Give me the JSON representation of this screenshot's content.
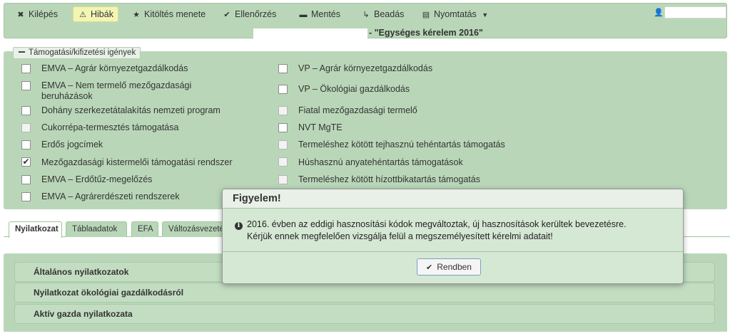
{
  "toolbar": {
    "items": [
      {
        "label": "Kilépés",
        "icon": "close-icon",
        "glyph": "✖"
      },
      {
        "label": "Hibák",
        "icon": "warning-icon",
        "glyph": "⚠"
      },
      {
        "label": "Kitöltés menete",
        "icon": "star-icon",
        "glyph": "★"
      },
      {
        "label": "Ellenőrzés",
        "icon": "check-icon",
        "glyph": "✔"
      },
      {
        "label": "Mentés",
        "icon": "save-icon",
        "glyph": "▬"
      },
      {
        "label": "Beadás",
        "icon": "send-icon",
        "glyph": "↳"
      },
      {
        "label": "Nyomtatás",
        "icon": "print-icon",
        "glyph": "▤"
      }
    ],
    "print_caret": "▼",
    "user_glyph": "👤",
    "title": "- \"Egységes kérelem 2016\""
  },
  "panel": {
    "legend": "Támogatási/kifizetési igények",
    "left": [
      {
        "label": "EMVA – Agrár környezetgazdálkodás",
        "checked": false,
        "disabled": false
      },
      {
        "label": "EMVA – Nem termelő mezőgazdasági beruházások",
        "checked": false,
        "disabled": false
      },
      {
        "label": "Dohány szerkezetátalakítás nemzeti program",
        "checked": false,
        "disabled": false
      },
      {
        "label": "Cukorrépa-termesztés támogatása",
        "checked": false,
        "disabled": true
      },
      {
        "label": "Erdős jogcímek",
        "checked": false,
        "disabled": false
      },
      {
        "label": "Mezőgazdasági kistermelői támogatási rendszer",
        "checked": true,
        "disabled": false
      },
      {
        "label": "EMVA – Erdőtűz-megelőzés",
        "checked": false,
        "disabled": false
      },
      {
        "label": "EMVA – Agrárerdészeti rendszerek",
        "checked": false,
        "disabled": false
      }
    ],
    "right": [
      {
        "label": "VP – Agrár környezetgazdálkodás",
        "checked": false,
        "disabled": false
      },
      {
        "label": "VP – Ökológiai gazdálkodás",
        "checked": false,
        "disabled": false
      },
      {
        "label": "Fiatal mezőgazdasági termelő",
        "checked": false,
        "disabled": true
      },
      {
        "label": "NVT MgTE",
        "checked": false,
        "disabled": false
      },
      {
        "label": "Termeléshez kötött tejhasznú tehéntartás támogatás",
        "checked": false,
        "disabled": true
      },
      {
        "label": "Húshasznú anyatehéntartás támogatások",
        "checked": false,
        "disabled": true
      },
      {
        "label": "Termeléshez kötött hízottbikatartás támogatás",
        "checked": false,
        "disabled": true
      }
    ]
  },
  "tabs": [
    "Nyilatkozat",
    "Táblaadatok",
    "EFA",
    "Változásvezetés"
  ],
  "accordion": [
    "Általános nyilatkozatok",
    "Nyilatkozat ökológiai gazdálkodásról",
    "Aktív gazda nyilatkozata"
  ],
  "dialog": {
    "title": "Figyelem!",
    "info_glyph": "i",
    "line1": "2016. évben az eddigi hasznosítási kódok megváltoztak, új hasznosítások kerültek bevezetésre.",
    "line2": "Kérjük ennek megfelelően vizsgálja felül a megszemélyesített kérelmi adatait!",
    "ok_glyph": "✔",
    "ok_label": "Rendben"
  },
  "colors": {
    "panel_bg": "#b9d7b8",
    "active_tab_bg": "#ffffff",
    "highlight": "#f3f5b5",
    "button_border": "#7b9fc4"
  }
}
